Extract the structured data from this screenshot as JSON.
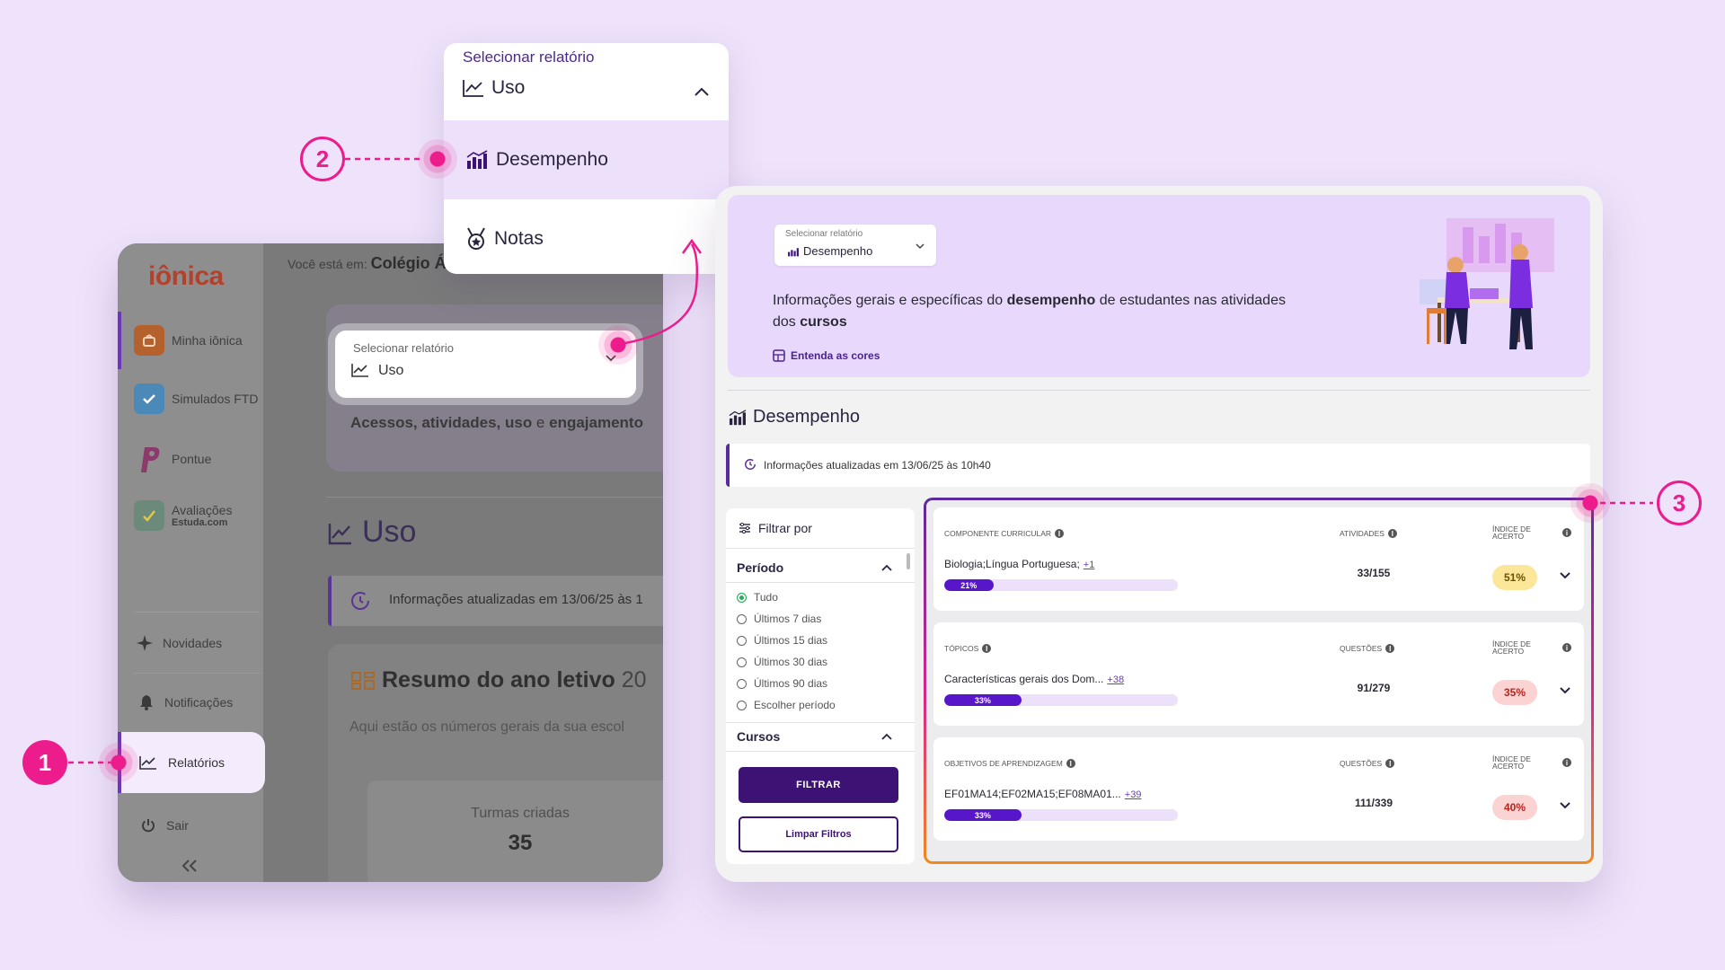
{
  "left_app": {
    "brand": "iônica",
    "you_are_in_label": "Você está em:",
    "school": "Colégio Á",
    "nav": [
      {
        "label": "Minha iônica"
      },
      {
        "label": "Simulados FTD"
      },
      {
        "label": "Pontue"
      },
      {
        "label": "Avaliações",
        "sub": "Estuda.com"
      },
      {
        "label": "Novidades"
      },
      {
        "label": "Notificações"
      },
      {
        "label": "Relatórios"
      },
      {
        "label": "Sair"
      }
    ],
    "report_select_label": "Selecionar relatório",
    "report_select_value": "Uso",
    "description_bold_1": "Acessos, atividades, uso",
    "description_mid": " e ",
    "description_bold_2": "engajamento",
    "section_title": "Uso",
    "info_text": "Informações atualizadas em 13/06/25 às 1",
    "resumo_title": "Resumo do ano letivo",
    "resumo_year": "20",
    "resumo_subtitle": "Aqui estão os números gerais da sua escol",
    "turmas_label": "Turmas criadas",
    "turmas_value": "35"
  },
  "dropdown": {
    "label": "Selecionar relatório",
    "current": "Uso",
    "options": [
      "Desempenho",
      "Notas"
    ]
  },
  "right_panel": {
    "hero": {
      "select_label": "Selecionar relatório",
      "select_value": "Desempenho",
      "desc_1": "Informações gerais e específicas do ",
      "desc_bold_1": "desempenho",
      "desc_2": " de estudantes nas atividades dos ",
      "desc_bold_2": "cursos",
      "link": "Entenda as cores"
    },
    "section_title": "Desempenho",
    "info_text": "Informações atualizadas em 13/06/25 às 10h40",
    "filter": {
      "title": "Filtrar por",
      "period_title": "Período",
      "period_options": [
        "Tudo",
        "Últimos 7 dias",
        "Últimos 15 dias",
        "Últimos 30 dias",
        "Últimos 90 dias",
        "Escolher período"
      ],
      "selected_period": "Tudo",
      "courses_title": "Cursos",
      "apply_button": "FILTRAR",
      "clear_button": "Limpar Filtros"
    },
    "rows": [
      {
        "col1_header": "COMPONENTE CURRICULAR",
        "col2_header": "ATIVIDADES",
        "col3_header_1": "ÍNDICE DE",
        "col3_header_2": "ACERTO",
        "name": "Biologia;Língua Portuguesa;",
        "more": "+1",
        "progress": 21,
        "progress_label": "21%",
        "count": "33/155",
        "index": "51%",
        "index_color": "#fbe69a",
        "index_text_color": "#6a5200"
      },
      {
        "col1_header": "TÓPICOS",
        "col2_header": "QUESTÕES",
        "col3_header_1": "ÍNDICE DE",
        "col3_header_2": "ACERTO",
        "name": "Características gerais dos Dom...",
        "more": "+38",
        "progress": 33,
        "progress_label": "33%",
        "count": "91/279",
        "index": "35%",
        "index_color": "#fbd3d3",
        "index_text_color": "#b3261e"
      },
      {
        "col1_header": "OBJETIVOS DE APRENDIZAGEM",
        "col2_header": "QUESTÕES",
        "col3_header_1": "ÍNDICE DE",
        "col3_header_2": "ACERTO",
        "name": "EF01MA14;EF02MA15;EF08MA01...",
        "more": "+39",
        "progress": 33,
        "progress_label": "33%",
        "count": "111/339",
        "index": "40%",
        "index_color": "#fbd3d3",
        "index_text_color": "#b3261e"
      }
    ]
  },
  "callouts": [
    "1",
    "2",
    "3"
  ],
  "colors": {
    "accent": "#ec1c8c",
    "primary": "#3d1275",
    "background": "#efe3fb"
  }
}
